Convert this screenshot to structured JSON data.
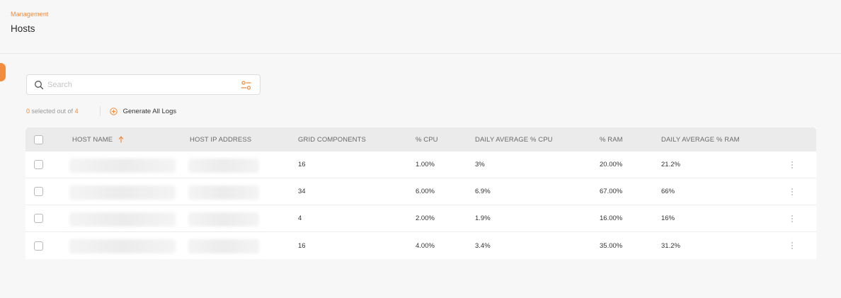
{
  "header": {
    "breadcrumb": "Management",
    "title": "Hosts"
  },
  "search": {
    "placeholder": "Search",
    "value": ""
  },
  "selection": {
    "prefix": "0",
    "text": " selected out of ",
    "total": "4"
  },
  "actions": {
    "generate_logs": "Generate All Logs"
  },
  "table": {
    "columns": [
      "HOST NAME",
      "HOST IP ADDRESS",
      "GRID COMPONENTS",
      "% CPU",
      "DAILY AVERAGE % CPU",
      "% RAM",
      "DAILY AVERAGE % RAM"
    ],
    "sort": {
      "column": "HOST NAME",
      "direction": "asc"
    },
    "rows": [
      {
        "grid": "16",
        "cpu": "1.00%",
        "avg_cpu": "3%",
        "ram": "20.00%",
        "avg_ram": "21.2%"
      },
      {
        "grid": "34",
        "cpu": "6.00%",
        "avg_cpu": "6.9%",
        "ram": "67.00%",
        "avg_ram": "66%"
      },
      {
        "grid": "4",
        "cpu": "2.00%",
        "avg_cpu": "1.9%",
        "ram": "16.00%",
        "avg_ram": "16%"
      },
      {
        "grid": "16",
        "cpu": "4.00%",
        "avg_cpu": "3.4%",
        "ram": "35.00%",
        "avg_ram": "31.2%"
      }
    ]
  },
  "colors": {
    "accent": "#f08a3a",
    "header_bg": "#ebebeb",
    "page_bg": "#f7f7f7"
  }
}
